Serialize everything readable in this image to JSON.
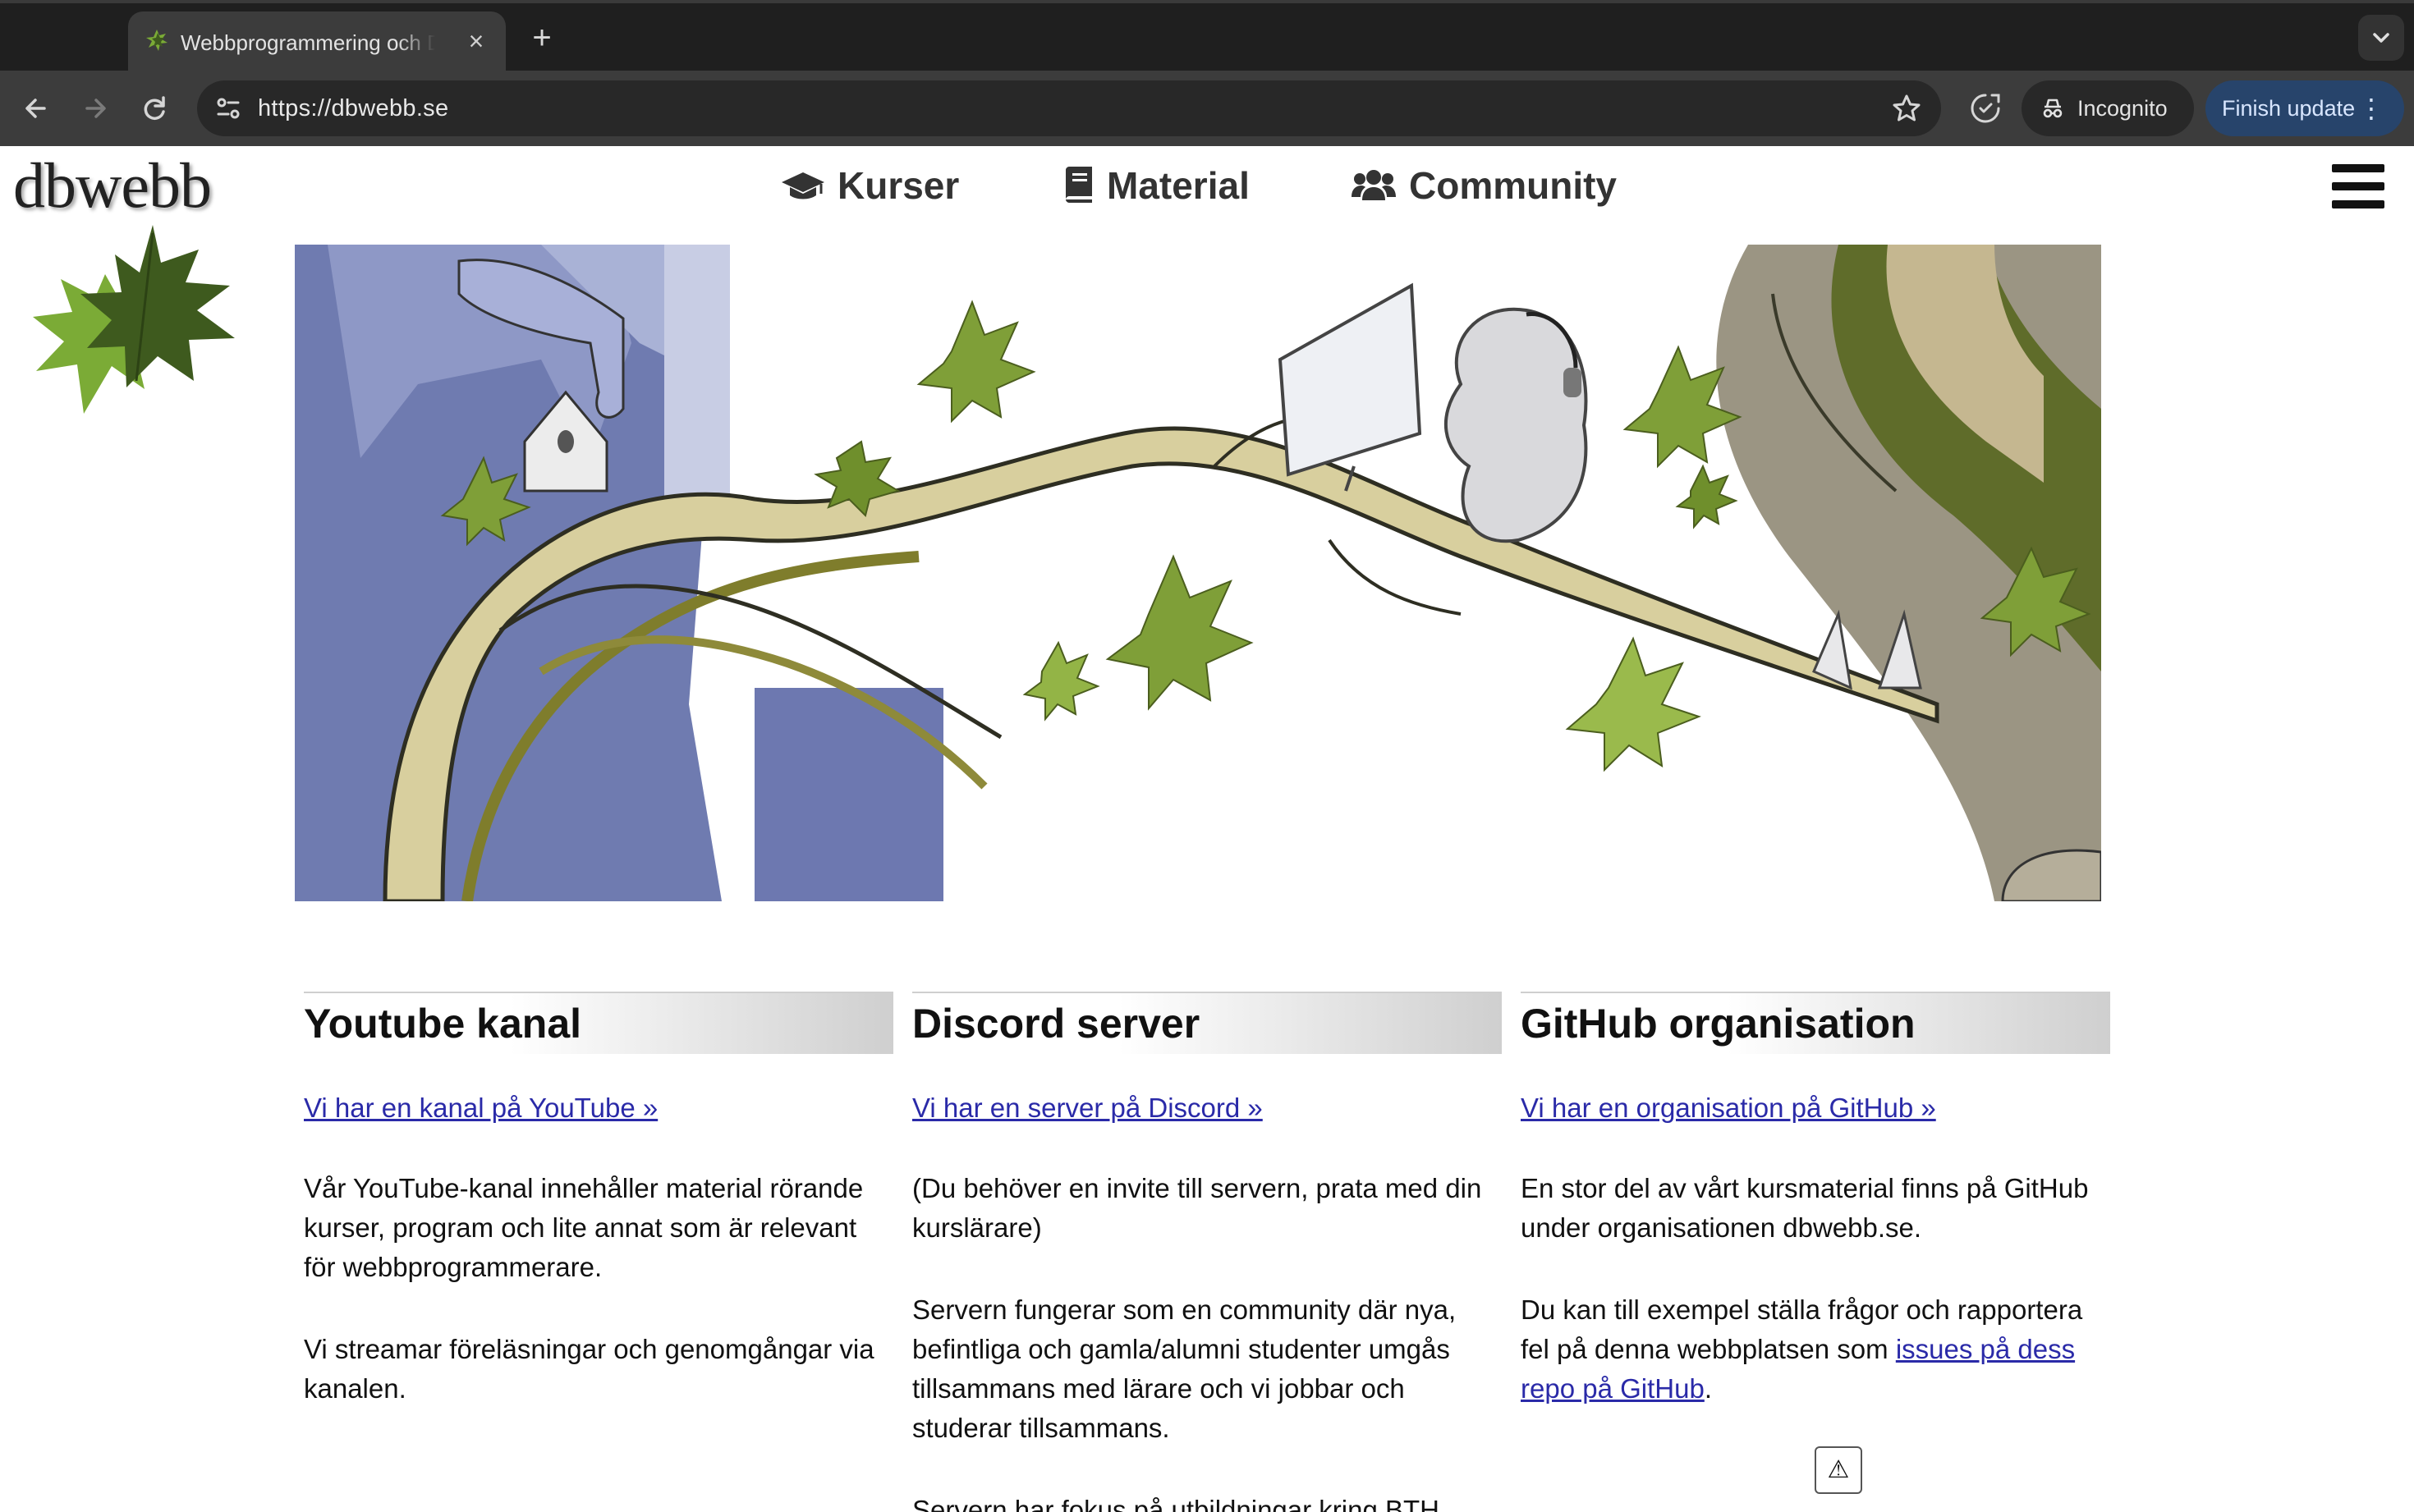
{
  "browser": {
    "tab_title": "Webbprogrammering och Databaser",
    "url": "https://dbwebb.se",
    "incognito_label": "Incognito",
    "finish_update_label": "Finish update"
  },
  "site": {
    "logo_text": "dbwebb",
    "nav": [
      {
        "label": "Kurser",
        "icon": "graduation-cap-icon"
      },
      {
        "label": "Material",
        "icon": "book-icon"
      },
      {
        "label": "Community",
        "icon": "users-icon"
      }
    ]
  },
  "columns": [
    {
      "title": "Youtube kanal",
      "link": "Vi har en kanal på YouTube »",
      "paragraphs": [
        "Vår YouTube-kanal innehåller material rörande kurser, program och lite annat som är relevant för webbprogrammerare.",
        "Vi streamar föreläsningar och genomgångar via kanalen."
      ]
    },
    {
      "title": "Discord server",
      "link": "Vi har en server på Discord »",
      "paragraphs": [
        "(Du behöver en invite till servern, prata med din kurslärare)",
        "Servern fungerar som en community där nya, befintliga och gamla/alumni studenter umgås tillsammans med lärare och vi jobbar och studerar tillsammans.",
        "Servern har fokus på utbildningar kring BTH"
      ]
    },
    {
      "title": "GitHub organisation",
      "link": "Vi har en organisation på GitHub »",
      "paragraphs": [
        "En stor del av vårt kursmaterial finns på GitHub under organisationen dbwebb.se."
      ],
      "p2_before": "Du kan till exempel ställa frågor och rapportera fel på denna webbplatsen som ",
      "p2_link": "issues på dess repo på GitHub",
      "p2_after": "."
    }
  ],
  "warning_glyph": "⚠",
  "colors": {
    "link": "#2a2aa8",
    "accent_update": "#27446b",
    "leaf_light": "#7bab36",
    "leaf_dark": "#3e5a1e"
  }
}
